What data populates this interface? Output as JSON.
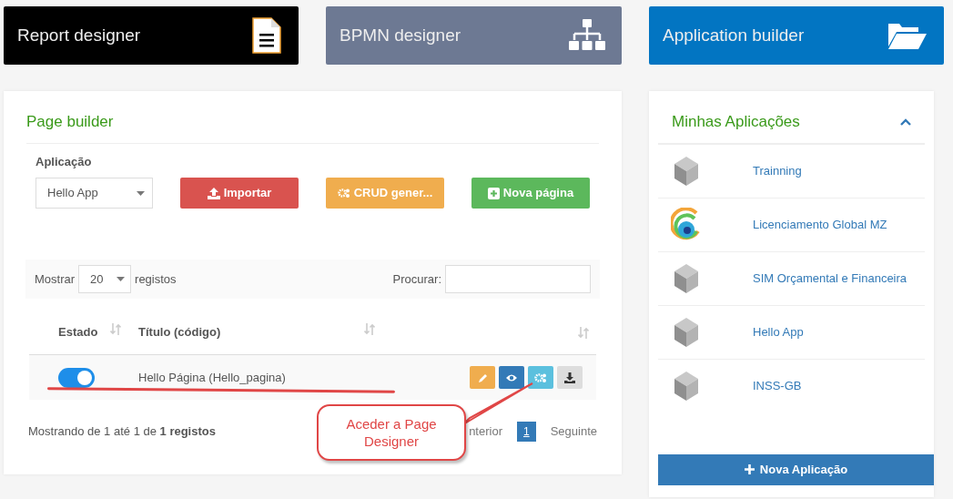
{
  "tiles": [
    {
      "label": "Report designer",
      "kind": "document",
      "color": "#000000"
    },
    {
      "label": "BPMN designer",
      "kind": "hierarchy",
      "color": "#6d7993"
    },
    {
      "label": "Application builder",
      "kind": "folder",
      "color": "#0275c2"
    }
  ],
  "page_builder": {
    "title": "Page builder",
    "application_label": "Aplicação",
    "application_value": "Hello App",
    "buttons": [
      {
        "label": "Importar",
        "kind": "import"
      },
      {
        "label": "CRUD gener...",
        "kind": "crud"
      },
      {
        "label": "Nova página",
        "kind": "new"
      }
    ],
    "table": {
      "show_label": "Mostrar",
      "page_size": "20",
      "show_suffix": "registos",
      "search_label": "Procurar:",
      "columns": [
        "Estado",
        "Título (código)"
      ],
      "rows": [
        {
          "on": true,
          "title": "Hello Página (Hello_pagina)",
          "actions": [
            {
              "kind": "edit"
            },
            {
              "kind": "view"
            },
            {
              "kind": "design"
            },
            {
              "kind": "download"
            }
          ]
        }
      ],
      "info": "Mostrando de 1 até 1 de **1 registos**",
      "previous": "nterior",
      "pages": [
        {
          "label": "1",
          "selected": true
        }
      ],
      "next": "Seguinte"
    },
    "annotation": "Aceder a Page Designer"
  },
  "applications": {
    "title": "Minhas Aplicações",
    "expanded": true,
    "items": [
      {
        "name": "Trainning",
        "kind": "cube"
      },
      {
        "name": "Licenciamento Global MZ",
        "kind": "spiral"
      },
      {
        "name": "SIM Orçamental e Financeira",
        "kind": "cube"
      },
      {
        "name": "Hello App",
        "kind": "cube"
      },
      {
        "name": "INSS-GB",
        "kind": "cube"
      }
    ],
    "new_button": "Nova Aplicação"
  }
}
